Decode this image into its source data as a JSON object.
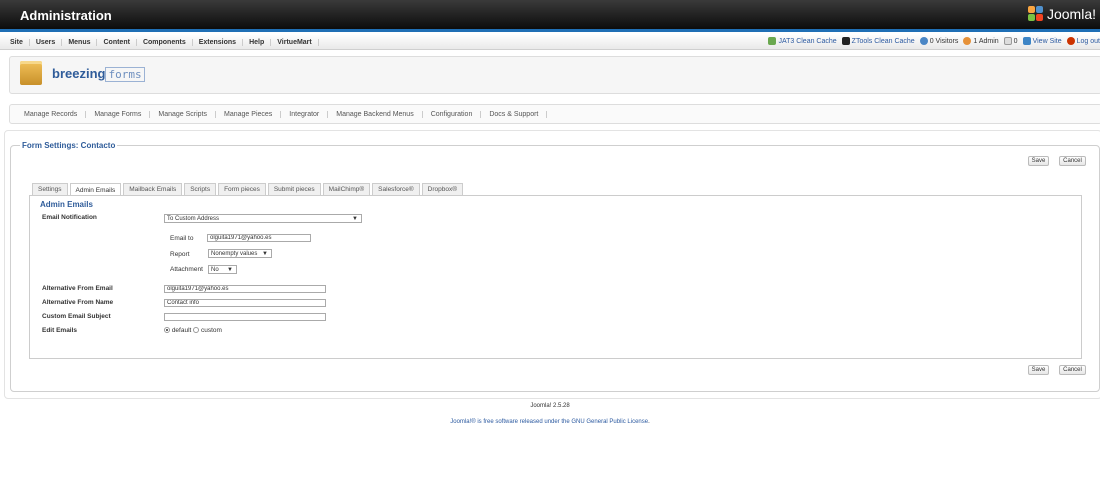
{
  "header": {
    "title": "Administration",
    "brand": "Joomla!"
  },
  "menubar": {
    "items": [
      "Site",
      "Users",
      "Menus",
      "Content",
      "Components",
      "Extensions",
      "Help",
      "VirtueMart"
    ],
    "right": {
      "jat3": "JAT3 Clean Cache",
      "ztools": "ZTools Clean Cache",
      "visitors": "0 Visitors",
      "admins": "1 Admin",
      "messages": "0",
      "view_site": "View Site",
      "logout": "Log out"
    }
  },
  "component": {
    "name_bold": "breezing",
    "name_thin": "forms"
  },
  "nav": [
    "Manage Records",
    "Manage Forms",
    "Manage Scripts",
    "Manage Pieces",
    "Integrator",
    "Manage Backend Menus",
    "Configuration",
    "Docs & Support"
  ],
  "form": {
    "legend": "Form Settings: Contacto",
    "save": "Save",
    "cancel": "Cancel",
    "tabs": [
      "Settings",
      "Admin Emails",
      "Mailback Emails",
      "Scripts",
      "Form pieces",
      "Submit pieces",
      "MailChimp®",
      "Salesforce®",
      "Dropbox®"
    ],
    "active_tab": "Admin Emails",
    "section_title": "Admin Emails",
    "email_notification": {
      "label": "Email Notification",
      "value": "To Custom Address"
    },
    "email_to": {
      "label": "Email to",
      "value": "olguita1971@yahoo.es"
    },
    "report": {
      "label": "Report",
      "value": "Nonempty values"
    },
    "attachment": {
      "label": "Attachment",
      "value": "No"
    },
    "alt_from_email": {
      "label": "Alternative From Email",
      "value": "olguita1971@yahoo.es"
    },
    "alt_from_name": {
      "label": "Alternative From Name",
      "value": "Contact info"
    },
    "custom_subject": {
      "label": "Custom Email Subject",
      "value": ""
    },
    "edit_emails": {
      "label": "Edit Emails",
      "options": [
        "default",
        "custom"
      ],
      "selected": "default"
    }
  },
  "footer": {
    "version": "Joomla! 2.5.28",
    "license_prefix": "Joomla!® is free software released under the ",
    "license_link": "GNU General Public License",
    "license_suffix": "."
  }
}
